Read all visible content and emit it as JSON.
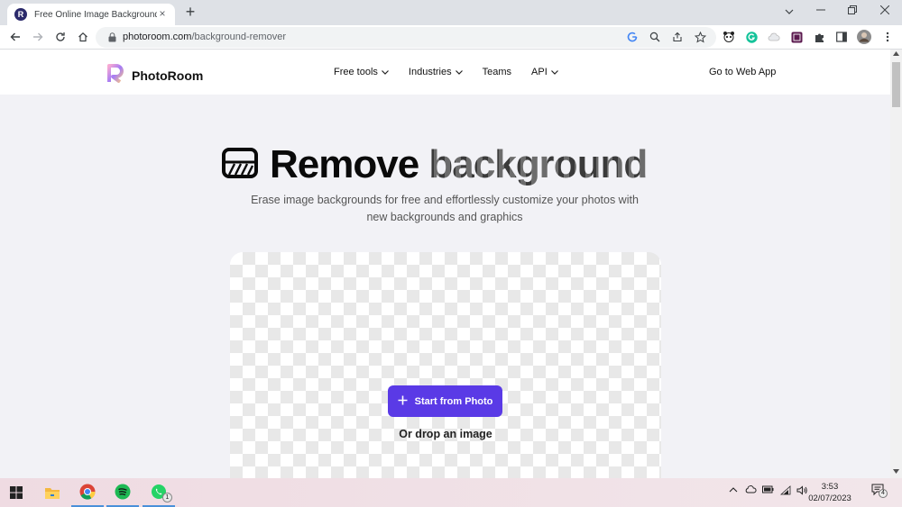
{
  "browser": {
    "tab_title": "Free Online Image Background R",
    "tab_favicon_letter": "R",
    "url_host": "photoroom.com",
    "url_path": "/background-remover",
    "new_tab_label": "+",
    "close_tab_label": "×"
  },
  "site": {
    "brand": "PhotoRoom",
    "nav": [
      {
        "label": "Free tools",
        "has_dropdown": true
      },
      {
        "label": "Industries",
        "has_dropdown": true
      },
      {
        "label": "Teams",
        "has_dropdown": false
      },
      {
        "label": "API",
        "has_dropdown": true
      }
    ],
    "cta": "Go to Web App"
  },
  "hero": {
    "title_word1": "Remove",
    "title_word2": "background",
    "subtitle": "Erase image backgrounds for free and effortlessly customize your photos with new backgrounds and graphics"
  },
  "upload": {
    "button_label": "Start from Photo",
    "drop_text": "Or drop an image"
  },
  "taskbar": {
    "time": "3:53",
    "date": "02/07/2023",
    "whatsapp_badge": "1",
    "notification_count": "4"
  },
  "colors": {
    "accent": "#5a3ae6",
    "page_bg": "#f2f2f6"
  }
}
